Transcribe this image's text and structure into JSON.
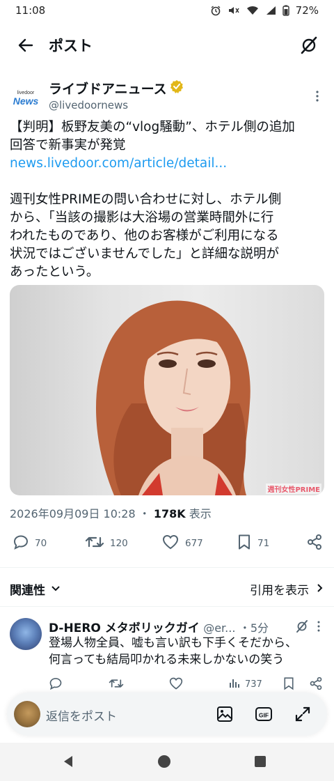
{
  "status_bar": {
    "time": "11:08",
    "battery": "72%",
    "icons": [
      "alarm-icon",
      "mute-icon",
      "wifi-icon",
      "signal-icon",
      "battery-icon"
    ]
  },
  "app_bar": {
    "title": "ポスト",
    "icons": [
      "back-arrow-icon",
      "grok-icon"
    ]
  },
  "post": {
    "author": {
      "logo_small": "livedoor",
      "logo_big": "News",
      "name": "ライブドアニュース",
      "handle": "@livedoornews",
      "verified_badge_color": "#e2b719"
    },
    "text_lines_1": [
      "【判明】板野友美の“vlog騒動”、ホテル側の追加",
      "回答で新事実が発覚"
    ],
    "link": "news.livedoor.com/article/detail...",
    "text_lines_2": [
      "週刊女性PRIMEの問い合わせに対し、ホテル側",
      "から、「当該の撮影は大浴場の営業時間外に行",
      "われたものであり、他のお客様がご利用になる",
      "状況ではございませんでした」と詳細な説明が",
      "あったという。"
    ],
    "image_watermark": "週刊女性PRIME",
    "timestamp": "2026年09月09日 10:28",
    "separator": "・",
    "views_value": "178K",
    "views_label": "表示",
    "stats": {
      "replies": "70",
      "reposts": "120",
      "likes": "677",
      "bookmarks": "71"
    }
  },
  "sort_row": {
    "left_label": "関連性",
    "right_label": "引用を表示"
  },
  "reply": {
    "name": "D-HERO メタボリックガイ",
    "handle": "@er...",
    "time": "・5分",
    "text_lines": [
      "登場人物全員、嘘も言い訳も下手くそだから、",
      "何言っても結局叩かれる未来しかないの笑う"
    ],
    "views": "737"
  },
  "composer": {
    "placeholder": "返信をポスト",
    "icons": [
      "image-icon",
      "gif-icon",
      "expand-icon"
    ],
    "gif_label": "GIF"
  },
  "colors": {
    "link": "#1d9bf0",
    "muted": "#536471",
    "text": "#0f1419"
  }
}
